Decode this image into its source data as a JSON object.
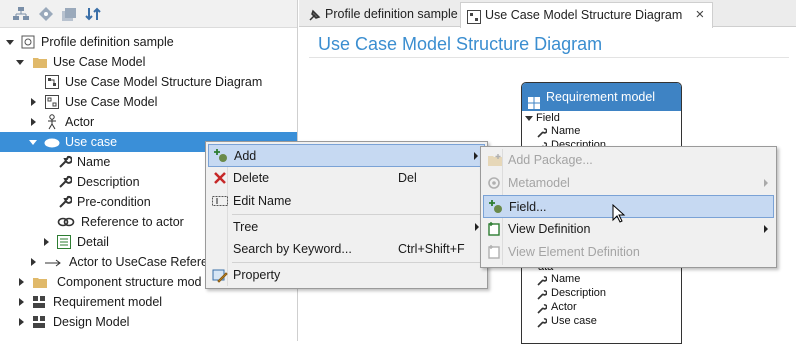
{
  "left_pane": {
    "toolbar_icons": [
      "hierarchy-icon",
      "diamond-icon",
      "stack-icon",
      "sort-icon"
    ],
    "tree": [
      {
        "label": "Profile definition sample",
        "icon": "profile-icon",
        "expanded": true,
        "level": 0
      },
      {
        "label": "Use Case Model",
        "icon": "folder-icon",
        "expanded": true,
        "level": 1
      },
      {
        "label": "Use Case Model Structure Diagram",
        "icon": "diagram-icon",
        "level": 2
      },
      {
        "label": "Use Case Model",
        "icon": "model-icon",
        "expanded": false,
        "level": 2
      },
      {
        "label": "Actor",
        "icon": "actor-icon",
        "expanded": false,
        "level": 2
      },
      {
        "label": "Use case",
        "icon": "ellipse-icon",
        "expanded": true,
        "level": 2,
        "selected": true
      },
      {
        "label": "Name",
        "icon": "wrench-icon",
        "level": 3
      },
      {
        "label": "Description",
        "icon": "wrench-icon",
        "level": 3
      },
      {
        "label": "Pre-condition",
        "icon": "wrench-icon",
        "level": 3
      },
      {
        "label": "Reference to actor",
        "icon": "link-icon",
        "level": 3
      },
      {
        "label": "Detail",
        "icon": "table-icon",
        "expanded": false,
        "level": 3
      },
      {
        "label": "Actor to UseCase Refere",
        "icon": "arrow-icon",
        "expanded": false,
        "level": 2
      },
      {
        "label": "Component structure mod",
        "icon": "folder-icon",
        "expanded": false,
        "level": 1
      },
      {
        "label": "Requirement model",
        "icon": "grid-icon",
        "expanded": false,
        "level": 1
      },
      {
        "label": "Design Model",
        "icon": "grid-icon",
        "expanded": false,
        "level": 1
      }
    ]
  },
  "tabs": [
    {
      "label": "Profile definition sample",
      "icon": "pin-icon",
      "active": false
    },
    {
      "label": "Use Case Model Structure Diagram",
      "icon": "diagram-icon",
      "active": true,
      "close": "×"
    }
  ],
  "diagram": {
    "title": "Use Case Model Structure Diagram",
    "requirement_box": {
      "title": "Requirement model",
      "field_header": "Field",
      "top_fields": [
        "Name",
        "Description"
      ],
      "bottom_prefix": "ata",
      "bottom_fields": [
        "Name",
        "Description",
        "Actor",
        "Use case"
      ]
    }
  },
  "context_menu": {
    "items": [
      {
        "label": "Add",
        "icon": "add-icon",
        "submenu": true,
        "highlighted": true
      },
      {
        "label": "Delete",
        "icon": "delete-x-icon",
        "shortcut": "Del"
      },
      {
        "label": "Edit Name",
        "icon": "edit-name-icon"
      },
      {
        "label": "Tree",
        "submenu": true
      },
      {
        "label": "Search by Keyword...",
        "shortcut": "Ctrl+Shift+F"
      },
      {
        "label": "Property",
        "icon": "property-icon"
      }
    ]
  },
  "sub_menu": {
    "items": [
      {
        "label": "Add Package...",
        "icon": "package-icon",
        "disabled": true
      },
      {
        "label": "Metamodel",
        "icon": "metamodel-icon",
        "disabled": true,
        "submenu": true
      },
      {
        "label": "Field...",
        "icon": "field-icon",
        "highlighted": true
      },
      {
        "label": "View Definition",
        "icon": "view-def-icon",
        "submenu": true
      },
      {
        "label": "View Element Definition",
        "icon": "view-element-icon",
        "disabled": true
      }
    ]
  },
  "colors": {
    "selection": "#3a8fd8",
    "accent_title": "#3b8ed0",
    "box_header": "#3e83c4",
    "menu_highlight": "#c6d9f2"
  }
}
